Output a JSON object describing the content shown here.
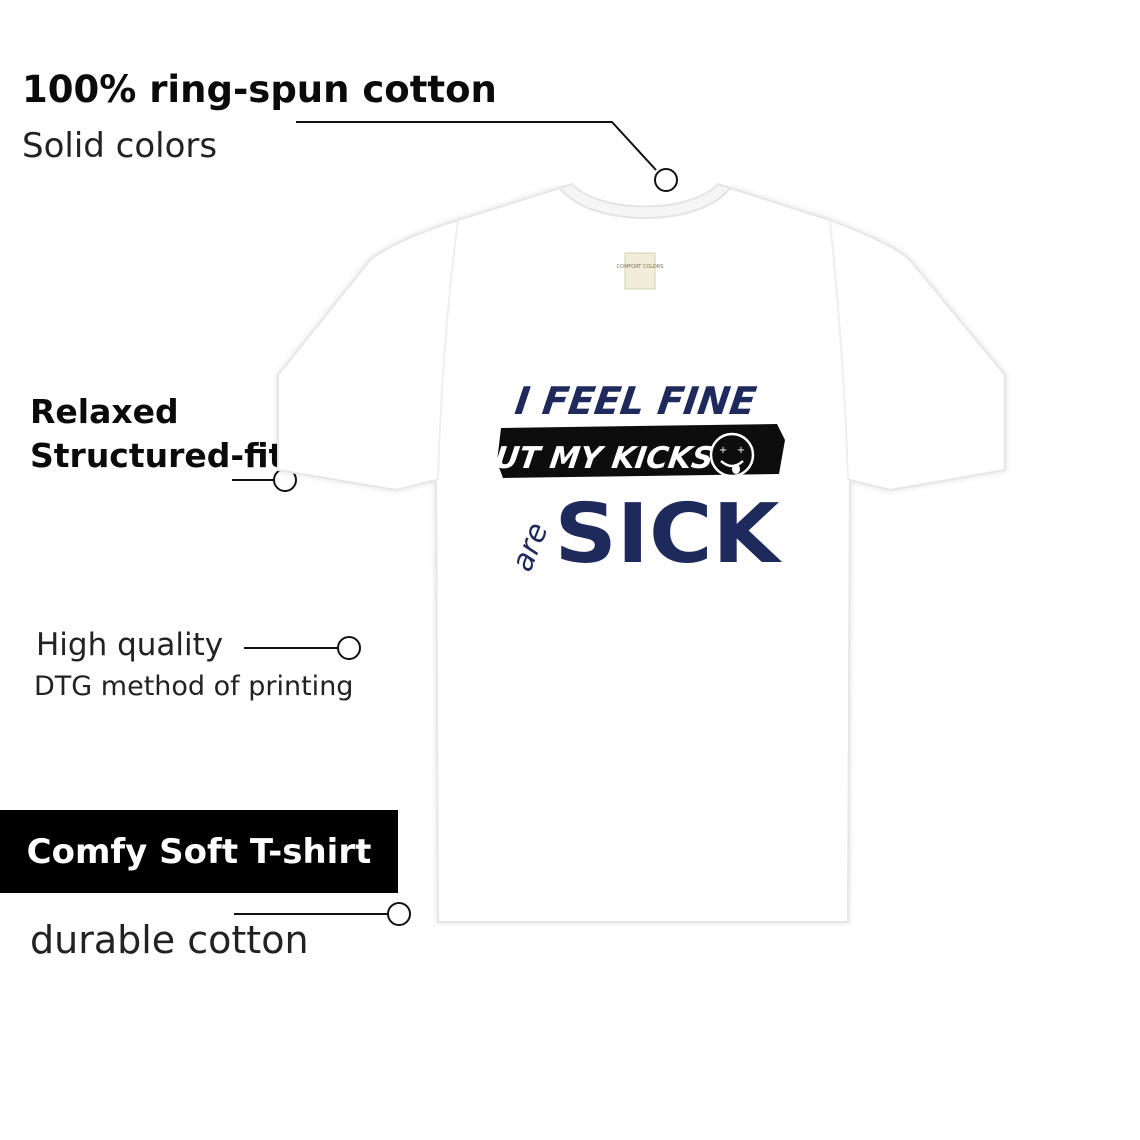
{
  "features": {
    "cotton": {
      "title": "100% ring-spun cotton",
      "subtitle": "Solid colors"
    },
    "fit": {
      "title": "Relaxed",
      "subtitle": "Structured-fit"
    },
    "print": {
      "title": "High quality",
      "subtitle": "DTG method of printing"
    },
    "comfort": {
      "badge": "Comfy Soft T-shirt",
      "subtitle": "durable cotton"
    }
  },
  "shirt": {
    "color": "#ffffff",
    "print_text": {
      "line1": "I FEEL FINE",
      "line2": "BUT MY KICKS",
      "line3_small": "are",
      "line3_big": "SICK"
    },
    "print_color": "#1f2a5c",
    "label_text": "COMFORT COLORS"
  },
  "colors": {
    "ink": "#000000",
    "navy": "#1f2a5c"
  }
}
